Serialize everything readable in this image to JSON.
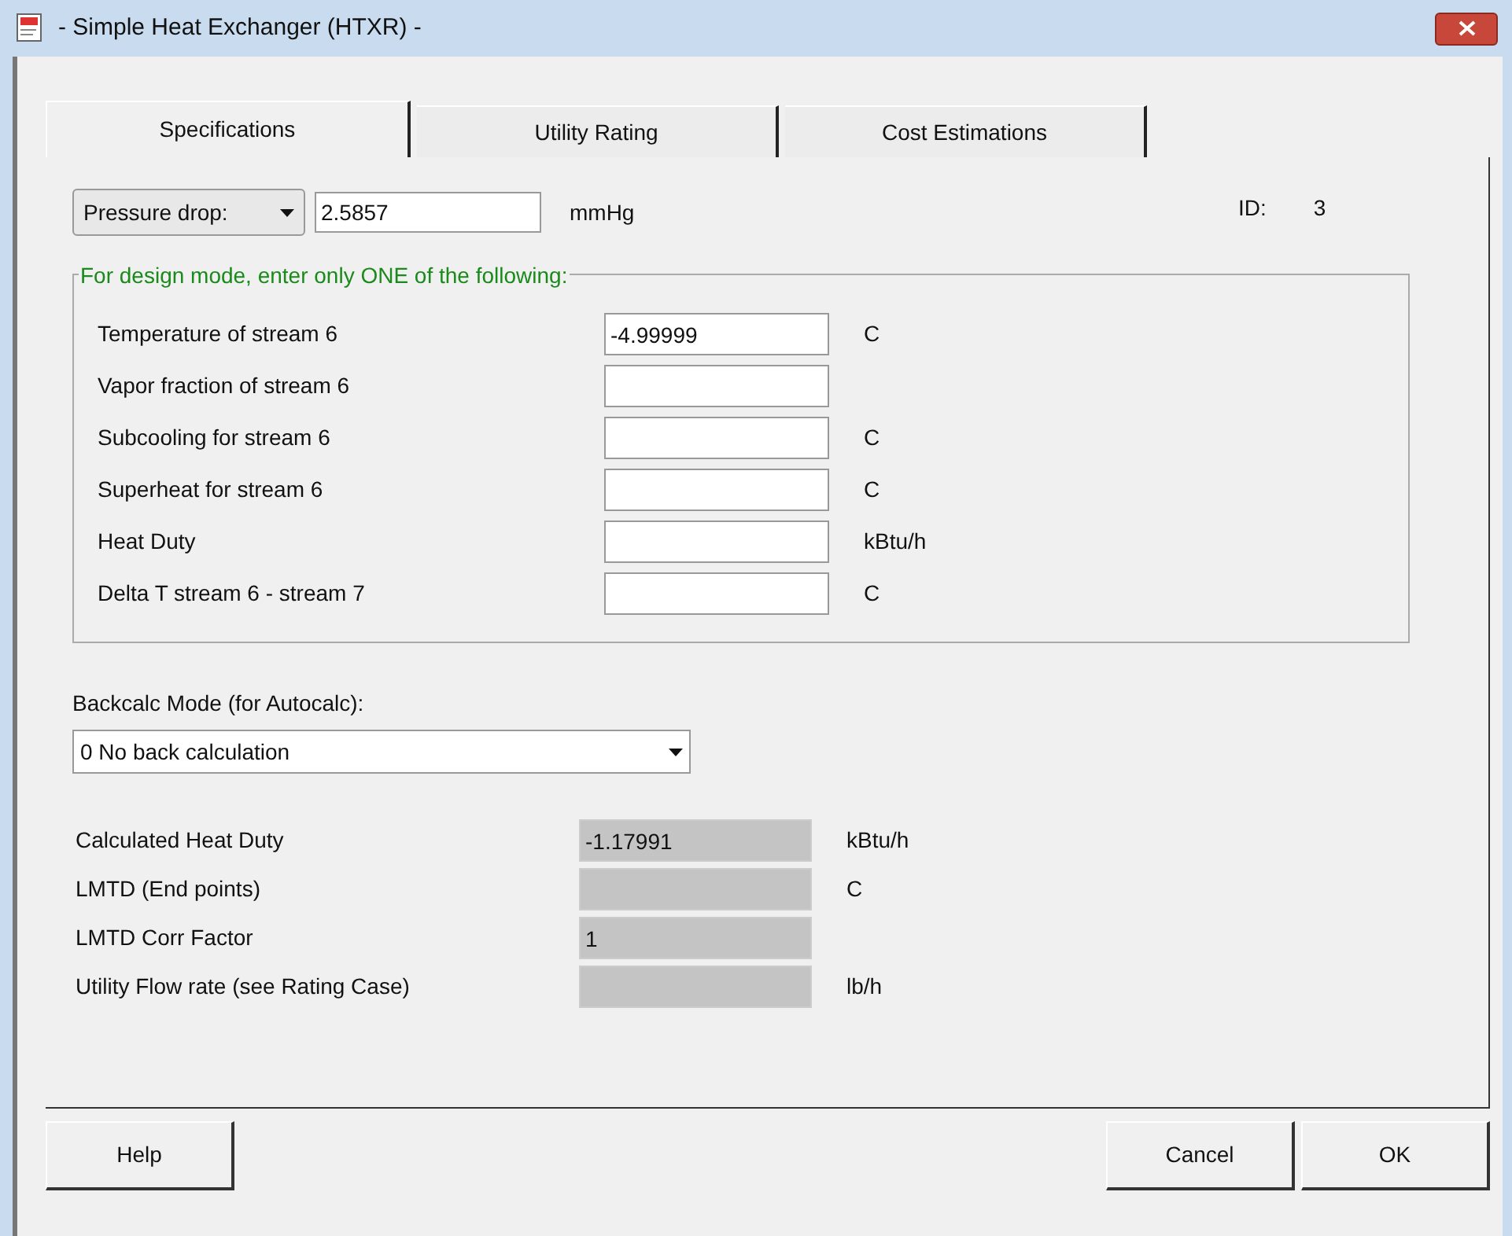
{
  "window": {
    "title": "- Simple Heat Exchanger (HTXR) -"
  },
  "tabs": [
    {
      "label": "Specifications",
      "selected": true
    },
    {
      "label": "Utility Rating",
      "selected": false
    },
    {
      "label": "Cost Estimations",
      "selected": false
    }
  ],
  "pressure": {
    "mode": "Pressure drop:",
    "value": "2.5857",
    "unit": "mmHg"
  },
  "id": {
    "label": "ID:",
    "value": "3"
  },
  "design_group": {
    "legend": "For design mode, enter only ONE of the following:",
    "fields": [
      {
        "label": "Temperature of stream  6",
        "value": "-4.99999",
        "unit": "C"
      },
      {
        "label": "Vapor fraction of stream 6"
      },
      {
        "label": "Subcooling for stream 6",
        "unit": "C"
      },
      {
        "label": "Superheat for stream 6",
        "unit": "C"
      },
      {
        "label": "Heat Duty",
        "unit": "kBtu/h"
      },
      {
        "label": "Delta T stream 6 - stream 7",
        "unit": "C"
      }
    ]
  },
  "backcalc": {
    "label": "Backcalc Mode (for Autocalc):",
    "value": "0 No back calculation"
  },
  "results": [
    {
      "label": "Calculated Heat Duty",
      "value": "-1.17991",
      "unit": "kBtu/h"
    },
    {
      "label": "LMTD (End points)",
      "unit": "C"
    },
    {
      "label": "LMTD Corr Factor",
      "value": "1"
    },
    {
      "label": "Utility Flow rate (see Rating Case)",
      "unit": "lb/h"
    }
  ],
  "buttons": [
    "Help",
    "Cancel",
    "OK"
  ]
}
